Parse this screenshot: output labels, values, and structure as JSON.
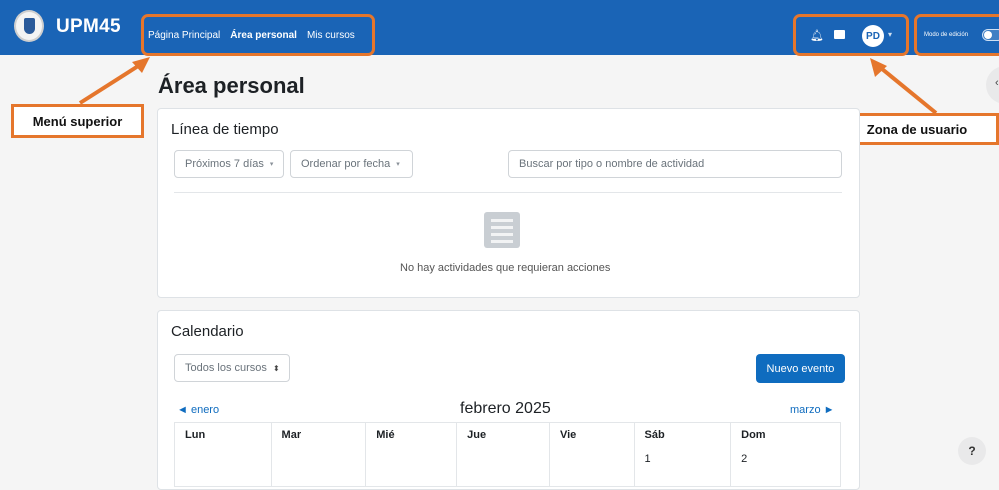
{
  "header": {
    "brand": "UPM45",
    "nav": [
      "Página Principal",
      "Área personal",
      "Mis cursos"
    ],
    "avatar_initials": "PD",
    "edit_mode_label": "Modo de edición"
  },
  "annotations": {
    "top_menu": "Menú superior",
    "user_zone": "Zona de usuario"
  },
  "page": {
    "title": "Área personal"
  },
  "timeline": {
    "title": "Línea de tiempo",
    "filter_days": "Próximos 7 días",
    "sort": "Ordenar por fecha",
    "search_placeholder": "Buscar por tipo o nombre de actividad",
    "empty_message": "No hay actividades que requieran acciones"
  },
  "calendar": {
    "title": "Calendario",
    "course_filter": "Todos los cursos",
    "new_event": "Nuevo evento",
    "prev_month": "enero",
    "current_month": "febrero 2025",
    "next_month": "marzo",
    "weekdays": [
      "Lun",
      "Mar",
      "Mié",
      "Jue",
      "Vie",
      "Sáb",
      "Dom"
    ],
    "first_row": [
      "",
      "",
      "",
      "",
      "",
      "1",
      "2"
    ]
  },
  "help": "?",
  "colors": {
    "header_bg": "#1a64b6",
    "annotation": "#e5762c",
    "primary": "#0f6cbf"
  }
}
